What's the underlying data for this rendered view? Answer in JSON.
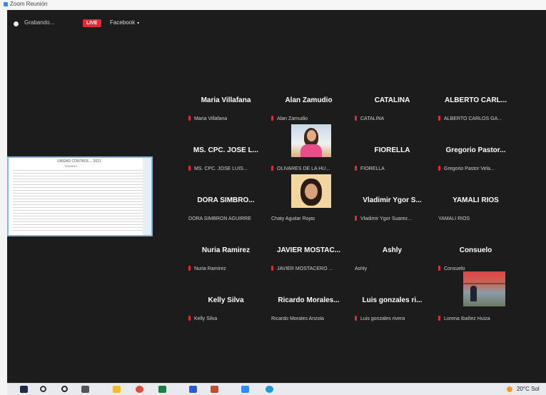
{
  "window": {
    "title": "Zoom Reunión"
  },
  "topbar": {
    "recording_label": "Grabando...",
    "live_label": "LIVE",
    "platform_label": "Facebook"
  },
  "shared_content": {
    "title": "UNIDAD CONTROL... 2021",
    "subtitle": "TEMARIO"
  },
  "participants": [
    {
      "big": "Maria Villafana",
      "foot": "Maria Villafana",
      "muted": true
    },
    {
      "big": "Alan Zamudio",
      "foot": "Alan Zamudio",
      "muted": true
    },
    {
      "big": "CATALINA",
      "foot": "CATALINA",
      "muted": true
    },
    {
      "big": "ALBERTO CARL...",
      "foot": "ALBERTO CARLOS GA...",
      "muted": true
    },
    {
      "big": "MS. CPC. JOSE L...",
      "foot": "MS. CPC. JOSE LUIS...",
      "muted": true
    },
    {
      "big": "",
      "foot": "OLIVARES DE LA HU...",
      "muted": true
    },
    {
      "big": "FIORELLA",
      "foot": "FIORELLA",
      "muted": true
    },
    {
      "big": "Gregorio Pastor...",
      "foot": "Gregorio Pastor Vela...",
      "muted": true
    },
    {
      "big": "DORA SIMBRO...",
      "foot": "DORA SIMBRON AGUIRRE",
      "muted": false
    },
    {
      "big": "",
      "foot": "Chaty Aguilar Rojas",
      "muted": false
    },
    {
      "big": "Vladimir Ygor S...",
      "foot": "Vladimir Ygor Suarez...",
      "muted": true
    },
    {
      "big": "YAMALI RIOS",
      "foot": "YAMALI RIOS",
      "muted": false
    },
    {
      "big": "Nuria Ramirez",
      "foot": "Nuria Ramirez",
      "muted": true
    },
    {
      "big": "JAVIER MOSTAC...",
      "foot": "JAVIER MOSTACERO ...",
      "muted": true
    },
    {
      "big": "Ashly",
      "foot": "Ashly",
      "muted": false
    },
    {
      "big": "Consuelo",
      "foot": "Consuelo",
      "muted": true
    },
    {
      "big": "Kelly Silva",
      "foot": "Kelly Silva",
      "muted": true
    },
    {
      "big": "Ricardo Morales...",
      "foot": "Ricardo Morales Arizola",
      "muted": false
    },
    {
      "big": "Luis gonzales ri...",
      "foot": "Luis gonzales rivera",
      "muted": true
    },
    {
      "big": "",
      "foot": "Lorena Ibañez Huiza",
      "muted": true
    }
  ],
  "taskbar": {
    "icons": [
      "windows-start-icon",
      "search-icon",
      "cortana-icon",
      "task-view-icon",
      "file-explorer-icon",
      "chrome-icon",
      "excel-icon",
      "word-icon",
      "powerpoint-icon",
      "zoom-icon",
      "edge-icon"
    ],
    "weather": "20°C Sol"
  },
  "colors": {
    "live_red": "#e02b35",
    "meeting_bg": "#1c1c1c",
    "zoom_blue": "#2d8cff"
  }
}
